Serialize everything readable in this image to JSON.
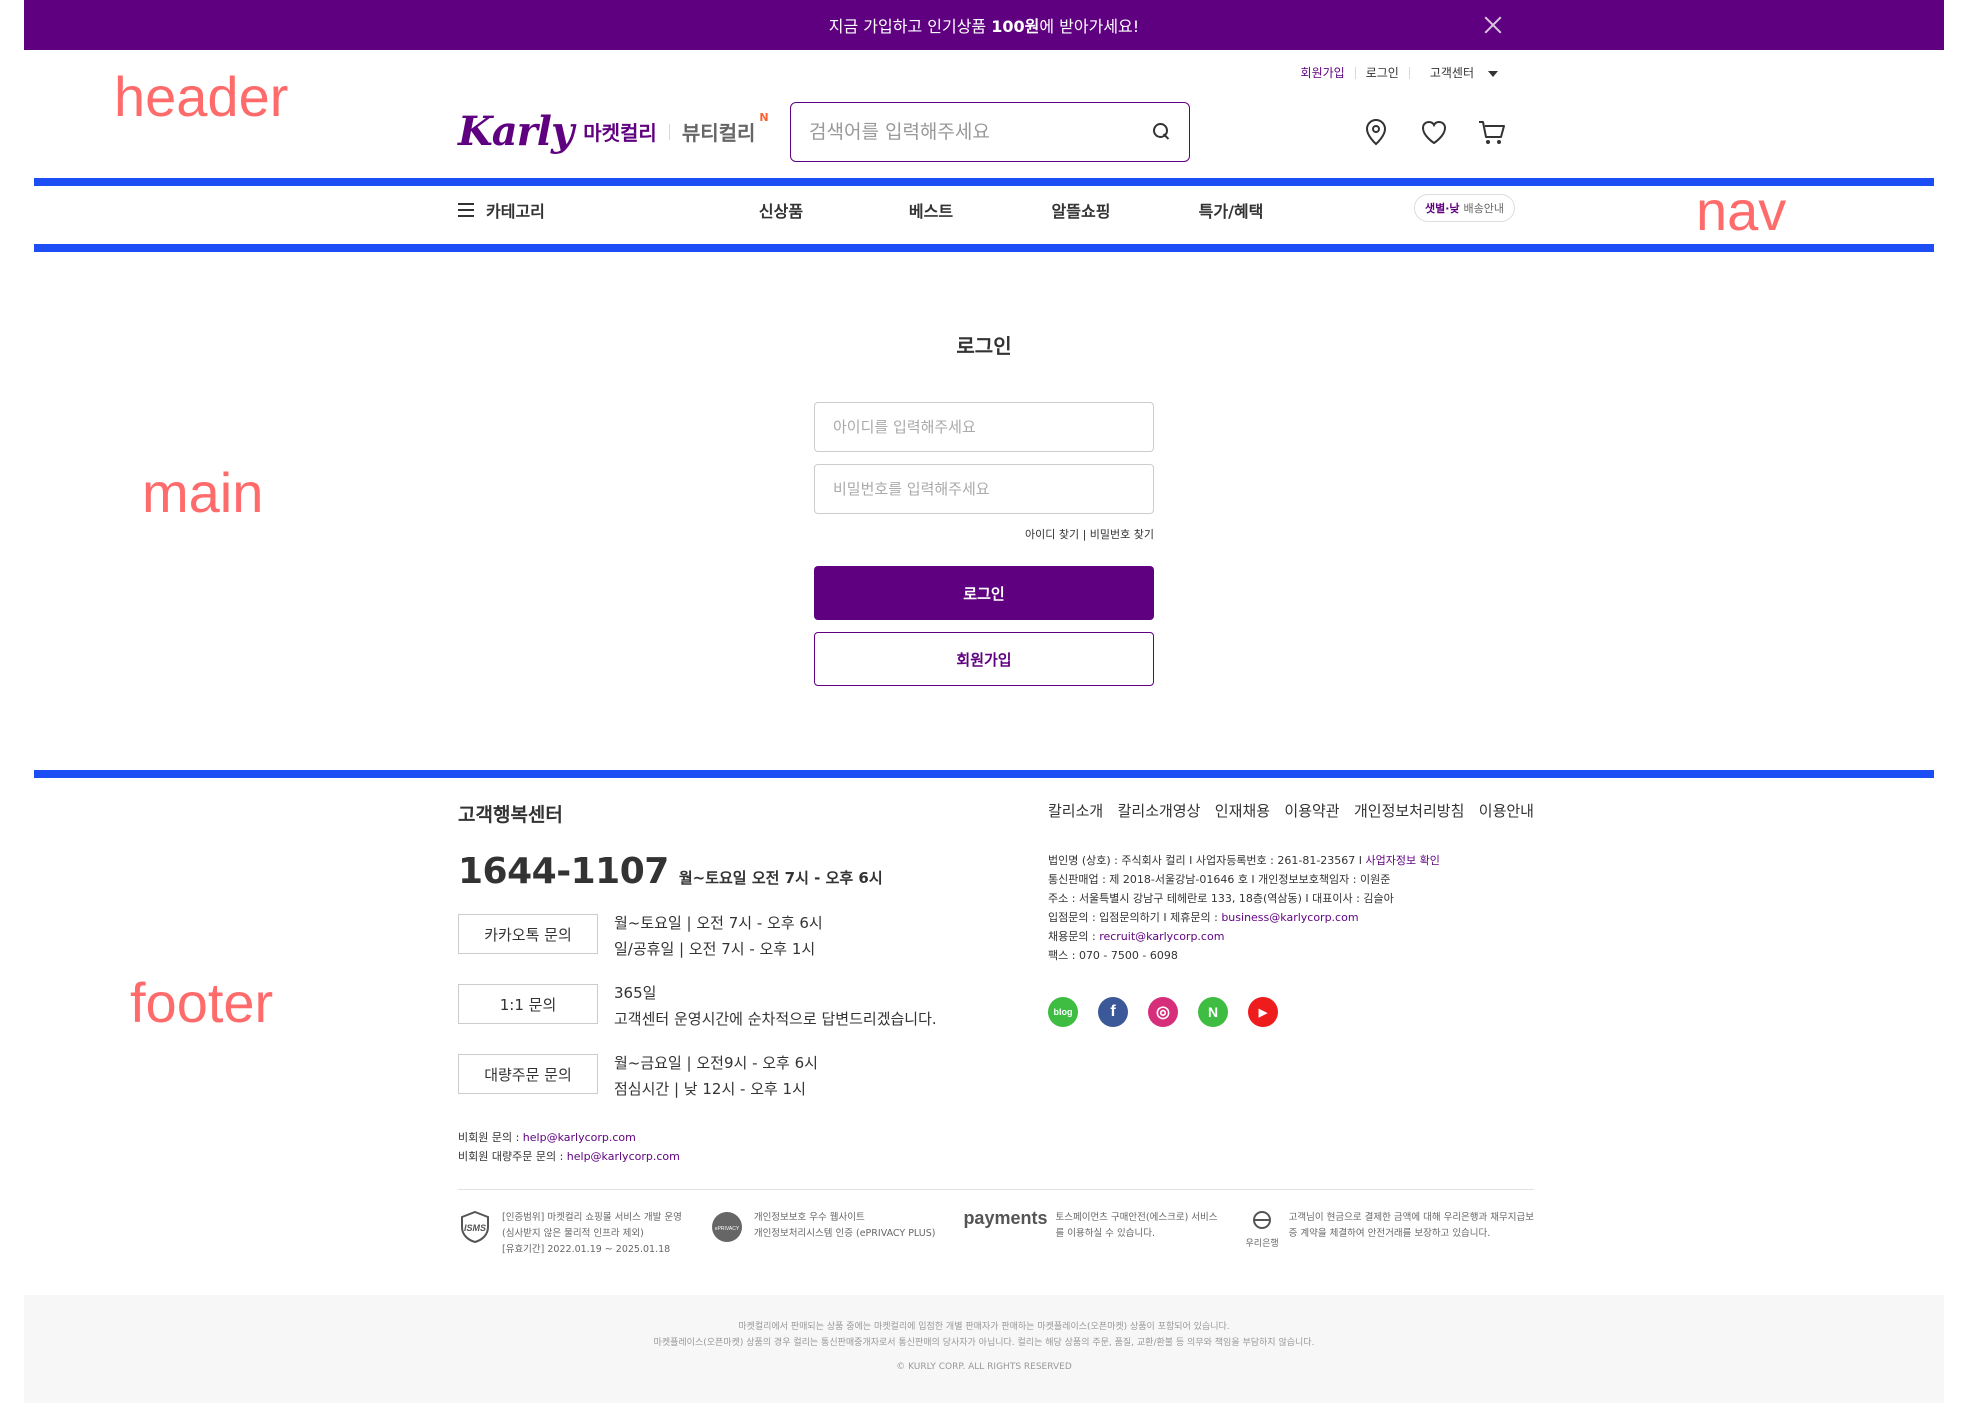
{
  "banner": {
    "text_prefix": "지금 가입하고 인기상품 ",
    "text_bold": "100원",
    "text_suffix": "에 받아가세요!"
  },
  "labels": {
    "header": "header",
    "nav": "nav",
    "main": "main",
    "footer": "footer"
  },
  "header": {
    "util": {
      "signup": "회원가입",
      "login": "로그인",
      "cs": "고객센터"
    },
    "logo": {
      "karly": "Karly",
      "market": "마켓컬리",
      "beauty": "뷰티컬리",
      "new": "N"
    },
    "search": {
      "placeholder": "검색어를 입력해주세요",
      "value": ""
    }
  },
  "nav": {
    "category": "카테고리",
    "menu": [
      "신상품",
      "베스트",
      "알뜰쇼핑",
      "특가/혜택"
    ],
    "delivery_highlight": "샛별·낮",
    "delivery_text": "배송안내"
  },
  "main": {
    "title": "로그인",
    "id_placeholder": "아이디를 입력해주세요",
    "pw_placeholder": "비밀번호를 입력해주세요",
    "find_id": "아이디 찾기",
    "find_pw": "비밀번호 찾기",
    "login_button": "로그인",
    "signup_button": "회원가입"
  },
  "footer": {
    "cs_title": "고객행복센터",
    "phone": "1644-1107",
    "phone_hours": "월~토요일 오전 7시 - 오후 6시",
    "rows": [
      {
        "button": "카카오톡 문의",
        "line1": "월~토요일 | 오전 7시 - 오후 6시",
        "line2": "일/공휴일 | 오전 7시 - 오후 1시"
      },
      {
        "button": "1:1 문의",
        "line1": "365일",
        "line2": "고객센터 운영시간에 순차적으로 답변드리겠습니다."
      },
      {
        "button": "대량주문 문의",
        "line1": "월~금요일 | 오전9시 - 오후 6시",
        "line2": "점심시간 | 낮 12시 - 오후 1시"
      }
    ],
    "email1_label": "비회원 문의 : ",
    "email1": "help@karlycorp.com",
    "email2_label": "비회원 대량주문 문의 : ",
    "email2": "help@karlycorp.com",
    "links": [
      "칼리소개",
      "칼리소개영상",
      "인재채용",
      "이용약관",
      "개인정보처리방침",
      "이용안내"
    ],
    "company": {
      "line1": "법인명 (상호) : 주식회사 컬리  I  사업자등록번호 : 261-81-23567  I  ",
      "line1_link": "사업자정보 확인",
      "line2": "통신판매업 : 제 2018-서울강남-01646 호  I  개인정보보호책임자 : 이원준",
      "line3": "주소 : 서울특별시 강남구 테헤란로 133, 18층(역삼동)  I  대표이사 : 김슬아",
      "line4": "입점문의 : 입점문의하기  I  제휴문의 : ",
      "line4_link": "business@karlycorp.com",
      "line5": "채용문의 : ",
      "line5_link": "recruit@karlycorp.com",
      "line6": "팩스 : 070 - 7500 - 6098"
    },
    "social": [
      {
        "name": "blog-icon",
        "glyph": "blog",
        "color": "#3ebd42"
      },
      {
        "name": "facebook-icon",
        "glyph": "f",
        "color": "#3b5998"
      },
      {
        "name": "instagram-icon",
        "glyph": "◎",
        "color": "#d62e7a"
      },
      {
        "name": "naver-post-icon",
        "glyph": "N",
        "color": "#3ebd42"
      },
      {
        "name": "youtube-icon",
        "glyph": "▶",
        "color": "#ee1c1c"
      }
    ],
    "certs": [
      {
        "logo": "ISMS",
        "lines": [
          "[인증범위] 마켓컬리 쇼핑몰 서비스 개발 운영",
          "(심사받지 않은 물리적 인프라 제외)",
          "[유효기간] 2022.01.19 ~ 2025.01.18"
        ]
      },
      {
        "logo": "ePRIVACY",
        "lines": [
          "개인정보보호 우수 웹사이트",
          "개인정보처리시스템 인증 (ePRIVACY PLUS)"
        ]
      },
      {
        "logo": "payments",
        "lines": [
          "토스페이먼츠 구매안전(에스크로) 서비스",
          "를 이용하실 수 있습니다."
        ]
      },
      {
        "logo": "우리은행",
        "lines": [
          "고객님이 현금으로 결제한 금액에 대해 우리은행과 채무지급보",
          "증 계약을 체결하여 안전거래를 보장하고 있습니다."
        ]
      }
    ],
    "bottom_line1": "마켓컬리에서 판매되는 상품 중에는 마켓컬리에 입점한 개별 판매자가 판매하는 마켓플레이스(오픈마켓) 상품이 포함되어 있습니다.",
    "bottom_line2": "마켓플레이스(오픈마켓) 상품의 경우 컬리는 통신판매중개자로서 통신판매의 당사자가 아닙니다. 컬리는 해당 상품의 주문, 품질, 교환/환불 등 의무와 책임을 부담하지 않습니다.",
    "copyright": "© KURLY CORP. ALL RIGHTS RESERVED"
  }
}
